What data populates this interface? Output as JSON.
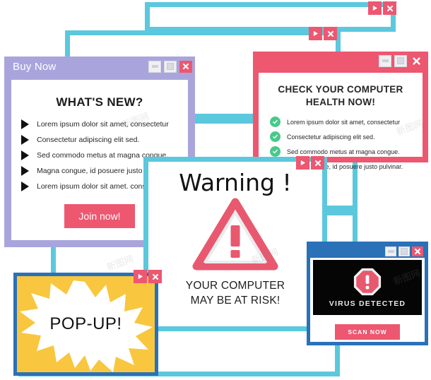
{
  "colors": {
    "teal": "#5bc8dd",
    "purple": "#a9a5dc",
    "pink": "#ed5770",
    "blue": "#2a71b8",
    "yellow": "#f8c73f",
    "green": "#48c98a",
    "black_panel": "#050505"
  },
  "buy_now_window": {
    "title": "Buy Now",
    "heading": "WHAT'S NEW?",
    "bullets": [
      "Lorem ipsum dolor sit amet, consectetur",
      "Consectetur adipiscing elit sed.",
      "Sed commodo metus at magna congue.",
      "Magna congue, id posuere justo pul",
      "Lorem ipsum dolor sit amet. consec"
    ],
    "cta_label": "Join now!",
    "controls": {
      "minimize": "minimize",
      "maximize": "maximize",
      "close": "close"
    }
  },
  "health_window": {
    "heading": "CHECK YOUR COMPUTER HEALTH NOW!",
    "heading_line_1": "CHECK YOUR COMPUTER",
    "heading_line_2": "HEALTH NOW!",
    "bullets": [
      "Lorem ipsum dolor sit amet, consectetur",
      "Consectetur adipiscing elit sed.",
      "Sed commodo metus at magna congue.",
      "Magna congue, id posuere justo pulvinar."
    ],
    "controls": {
      "minimize": "minimize",
      "maximize": "maximize",
      "close": "close"
    }
  },
  "warning_window": {
    "title": "Warning !",
    "subtitle_line_1": "YOUR COMPUTER",
    "subtitle_line_2": "MAY BE AT RISK!",
    "icon": "warning-triangle-exclamation"
  },
  "popup_window": {
    "label": "POP-UP!",
    "controls": {
      "play": "play",
      "close": "close"
    }
  },
  "virus_window": {
    "label": "VIRUS DETECTED",
    "button_label": "SCAN NOW",
    "icon": "octagon-exclamation",
    "controls": {
      "minimize": "minimize",
      "maximize": "maximize",
      "close": "close"
    }
  },
  "empty_frames": [
    {
      "name": "frame-top-right"
    },
    {
      "name": "frame-upper-mid"
    },
    {
      "name": "frame-mid-right"
    },
    {
      "name": "frame-lower-mid"
    },
    {
      "name": "frame-bottom"
    }
  ],
  "watermark": {
    "text": "新图网"
  }
}
